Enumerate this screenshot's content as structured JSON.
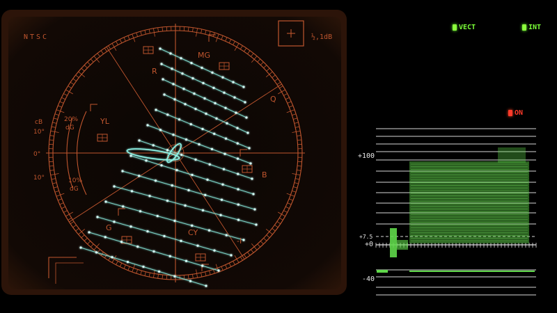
{
  "vectorscope": {
    "standard": "NTSC",
    "gain": "½,1dB",
    "targets": [
      "R",
      "MG",
      "B",
      "CY",
      "G",
      "YL"
    ],
    "axes": [
      "Q",
      "-I"
    ],
    "left_scale": {
      "cb": "cB",
      "deg_top": "10°",
      "zero": "0°",
      "deg_bottom": "10°",
      "pct_top": "20%",
      "dg_top": "dG",
      "pct_bottom": "10%",
      "dg_bottom": "dG"
    }
  },
  "indicators": {
    "vect": "VECT",
    "int": "INT",
    "on": "ON",
    "vect_color": "#7bff38",
    "on_color": "#ff3a2a"
  },
  "waveform": {
    "labels": {
      "top": "+100",
      "setup": "+7.5",
      "zero": "+0",
      "bottom": "-40"
    }
  },
  "colors": {
    "graticule": "#c0562e",
    "trace": "#8ff6e8",
    "waveform": "#5fd84a"
  }
}
